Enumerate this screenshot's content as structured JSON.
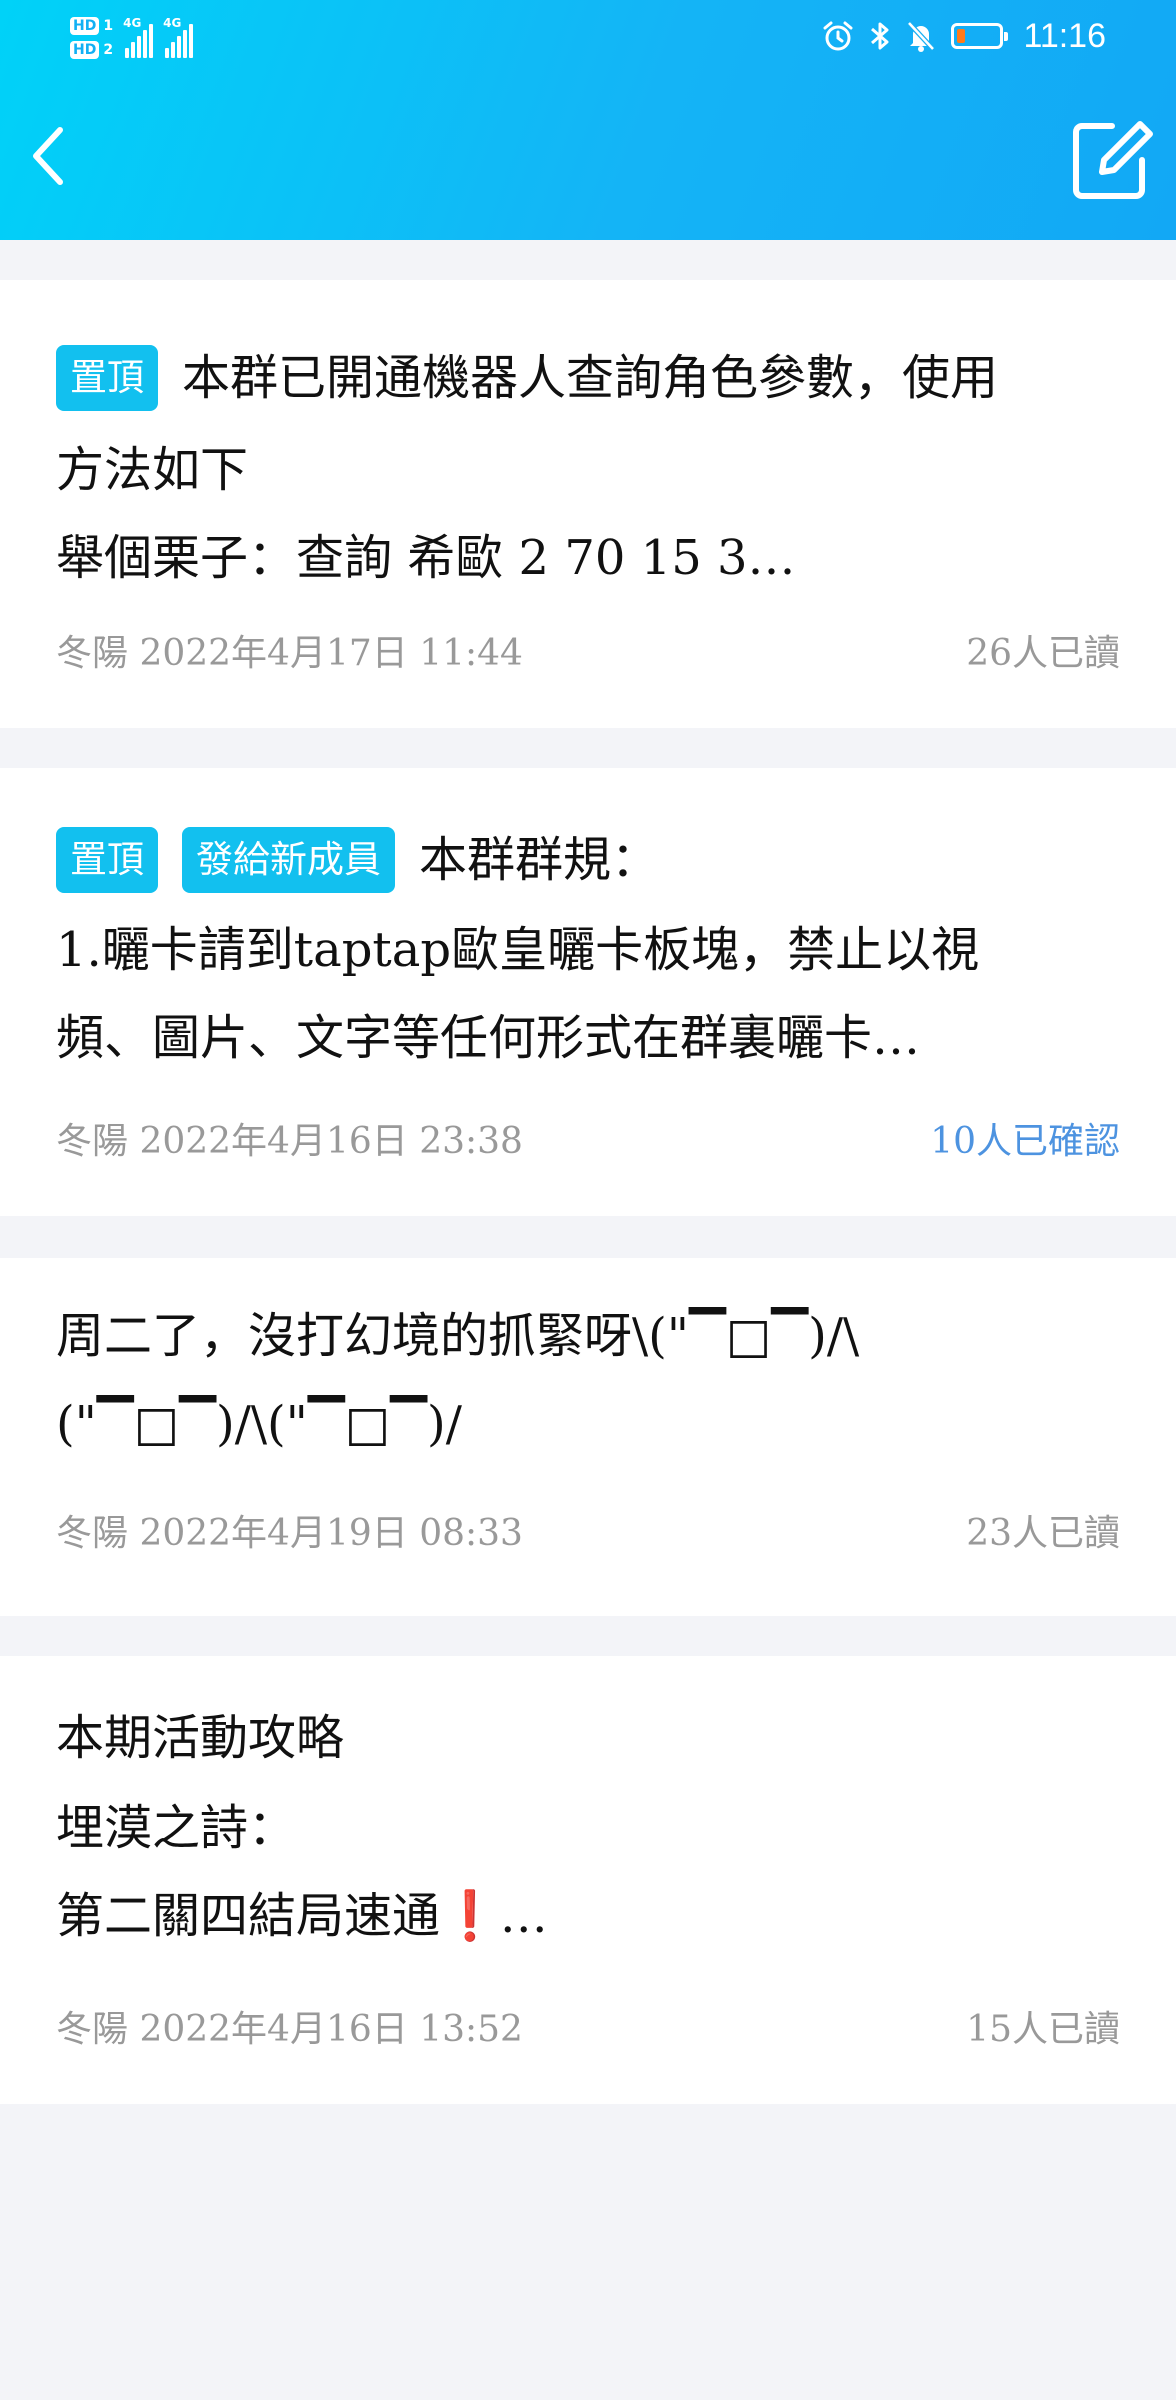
{
  "status_bar": {
    "hd1": "HD",
    "hd1_num": "1",
    "hd2": "HD",
    "hd2_num": "2",
    "net1": "4G",
    "net2": "4G",
    "time": "11:16",
    "battery_level": 0.2,
    "battery_color": "#ff7a1a"
  },
  "header": {
    "back_icon": "chevron-left-icon",
    "edit_icon": "edit-note-icon",
    "gradient": [
      "#00d2f8",
      "#12a8f5"
    ]
  },
  "announcements": [
    {
      "tags": [
        "置頂"
      ],
      "lines": [
        "本群已開通機器人查詢角色參數，使用",
        "方法如下",
        "舉個栗子：查詢 希歐 2 70 15 3…"
      ],
      "author_time": "冬陽 2022年4月17日 11:44",
      "status": "26人已讀"
    },
    {
      "tags": [
        "置頂",
        "發給新成員"
      ],
      "lines": [
        "本群群規：",
        "1.曬卡請到taptap歐皇曬卡板塊，禁止以視",
        "頻、圖片、文字等任何形式在群裏曬卡…"
      ],
      "author_time": "冬陽 2022年4月16日 23:38",
      "status": "10人已確認"
    },
    {
      "tags": [],
      "lines": [
        "周二了，沒打幻境的抓緊呀\\(\"▔□▔)/\\",
        "(\"▔□▔)/\\(\"▔□▔)/"
      ],
      "author_time": "冬陽 2022年4月19日 08:33",
      "status": "23人已讀"
    },
    {
      "tags": [],
      "lines": [
        "本期活動攻略",
        "埋漠之詩：",
        "第二關四結局速通"
      ],
      "line3_emoji": "❗",
      "line3_suffix": "…",
      "author_time": "冬陽 2022年4月16日 13:52",
      "status": "15人已讀"
    }
  ],
  "colors": {
    "tag_bg": "#12c0ef",
    "meta_text": "#999999",
    "confirm_link": "#4d93e0",
    "page_bg": "#f3f4f8"
  }
}
